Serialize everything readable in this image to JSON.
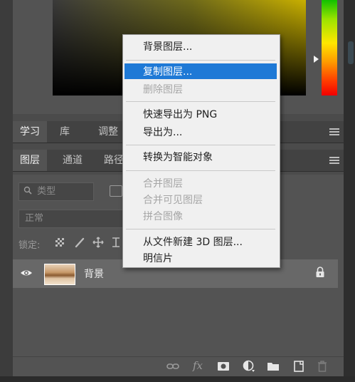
{
  "colors": {
    "menu_highlight": "#1e79d6",
    "panel": "#535353",
    "tabbar": "#424242"
  },
  "top_tabs": {
    "learn": "学习",
    "library": "库",
    "adjust": "调整"
  },
  "layer_tabs": {
    "layers": "图层",
    "channels": "通道",
    "paths": "路径"
  },
  "filter": {
    "kind_placeholder": "类型"
  },
  "blend_mode": {
    "value": "正常"
  },
  "lock": {
    "label": "锁定:"
  },
  "layers": [
    {
      "name": "背景",
      "visible": true,
      "locked": true
    }
  ],
  "context_menu": {
    "items": [
      {
        "label": "背景图层...",
        "enabled": true
      },
      {
        "label": "复制图层...",
        "enabled": true,
        "highlighted": true
      },
      {
        "label": "删除图层",
        "enabled": false
      },
      {
        "label": "快速导出为 PNG",
        "enabled": true
      },
      {
        "label": "导出为...",
        "enabled": true
      },
      {
        "label": "转换为智能对象",
        "enabled": true
      },
      {
        "label": "合并图层",
        "enabled": false
      },
      {
        "label": "合并可见图层",
        "enabled": false
      },
      {
        "label": "拼合图像",
        "enabled": false
      },
      {
        "label": "从文件新建 3D 图层...",
        "enabled": true
      },
      {
        "label": "明信片",
        "enabled": true
      }
    ]
  },
  "bottom_toolbar": {
    "icons": [
      "link-icon",
      "fx-icon",
      "mask-icon",
      "adjustment-layer-icon",
      "group-folder-icon",
      "new-layer-icon",
      "trash-icon"
    ],
    "fx_label": "fx"
  }
}
